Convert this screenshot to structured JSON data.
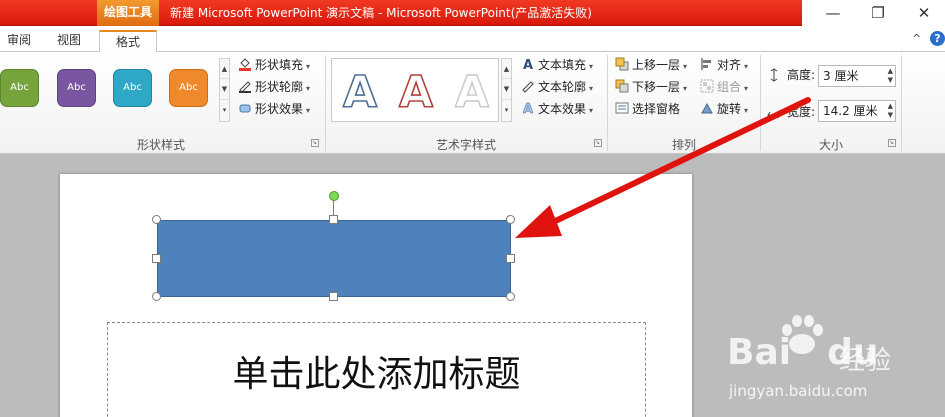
{
  "titlebar": {
    "context_tool": "绘图工具",
    "title": "新建 Microsoft PowerPoint 演示文稿  -  Microsoft PowerPoint(产品激活失败)",
    "minimize": "—",
    "maximize": "❐",
    "close": "✕",
    "accent": "#e41e10"
  },
  "tabs": [
    {
      "label": "审阅"
    },
    {
      "label": "视图"
    },
    {
      "label": "格式",
      "active": true
    }
  ],
  "tabrow": {
    "collapse_icon": "^",
    "help_icon": "?"
  },
  "shape_styles": {
    "swatches": [
      {
        "label": "Abc",
        "color": "#77a33c"
      },
      {
        "label": "Abc",
        "color": "#7a56a0"
      },
      {
        "label": "Abc",
        "color": "#2ea8c6"
      },
      {
        "label": "Abc",
        "color": "#f0892c"
      }
    ],
    "fill": "形状填充",
    "outline": "形状轮廓",
    "effects": "形状效果",
    "group_label": "形状样式"
  },
  "wordart": {
    "fill": "文本填充",
    "outline": "文本轮廓",
    "effects": "文本效果",
    "group_label": "艺术字样式",
    "glyph": "A"
  },
  "arrange": {
    "bring_forward": "上移一层",
    "send_backward": "下移一层",
    "selection_pane": "选择窗格",
    "align": "对齐",
    "group": "组合",
    "rotate": "旋转",
    "group_label": "排列"
  },
  "size": {
    "height_label": "高度:",
    "height_value": "3 厘米",
    "width_label": "宽度:",
    "width_value": "14.2 厘米",
    "group_label": "大小"
  },
  "slide": {
    "title_placeholder": "单击此处添加标题",
    "shape_color": "#4f81bd"
  },
  "annotation": {
    "arrow_color": "#e0140e"
  },
  "watermark": {
    "brand": "Bai",
    "brand_tail": "du",
    "cn": "经验",
    "url": "jingyan.baidu.com"
  }
}
